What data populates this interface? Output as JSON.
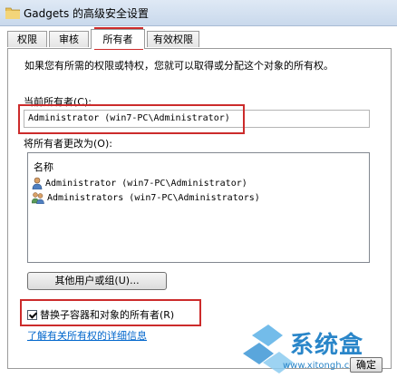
{
  "window": {
    "title": "Gadgets 的高级安全设置"
  },
  "tabs": [
    {
      "label": "权限"
    },
    {
      "label": "审核"
    },
    {
      "label": "所有者"
    },
    {
      "label": "有效权限"
    }
  ],
  "owner_tab": {
    "intro": "如果您有所需的权限或特权，您就可以取得或分配这个对象的所有权。",
    "current_owner_label": "当前所有者(C):",
    "current_owner_value": "Administrator (win7-PC\\Administrator)",
    "change_to_label": "将所有者更改为(O):",
    "list_header": "名称",
    "list_items": [
      {
        "name": "Administrator (win7-PC\\Administrator)",
        "icon": "user-icon"
      },
      {
        "name": "Administrators (win7-PC\\Administrators)",
        "icon": "users-group-icon"
      }
    ],
    "other_users_button": "其他用户或组(U)...",
    "replace_checkbox_label": "替换子容器和对象的所有者(R)",
    "replace_checkbox_checked": true,
    "learn_more_link": "了解有关所有权的详细信息"
  },
  "footer": {
    "ok_button": "确定"
  },
  "watermark": {
    "text": "系统盒",
    "url": "www.xitongh.com"
  },
  "colors": {
    "highlight_border": "#cc2b2b",
    "link": "#0066cc",
    "watermark": "#2a86c9"
  }
}
